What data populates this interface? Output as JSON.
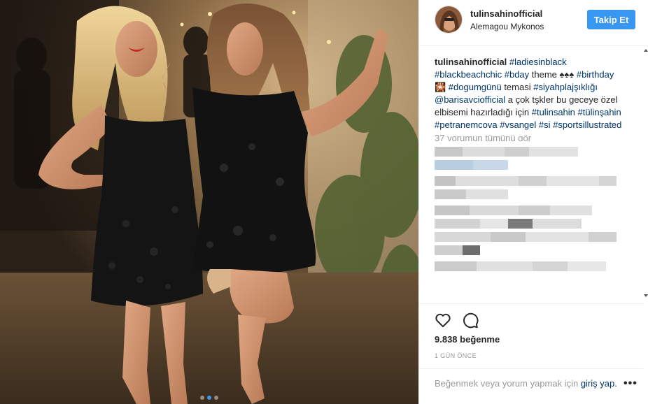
{
  "post": {
    "username": "tulinsahinofficial",
    "location": "Alemagou Mykonos",
    "follow_label": "Takip Et"
  },
  "caption": {
    "author": "tulinsahinofficial",
    "parts": [
      {
        "type": "tag",
        "text": "#ladiesinblack"
      },
      {
        "type": "tag",
        "text": "#blackbeachchic"
      },
      {
        "type": "tag",
        "text": "#bday"
      },
      {
        "type": "text",
        "text": "theme ♠♠♠"
      },
      {
        "type": "tag",
        "text": "#birthday"
      },
      {
        "type": "text",
        "text": "🎇"
      },
      {
        "type": "tag",
        "text": "#dogumgünü"
      },
      {
        "type": "text",
        "text": "temasi"
      },
      {
        "type": "tag",
        "text": "#siyahplajşıklığı"
      },
      {
        "type": "tag",
        "text": "@barisavciofficial"
      },
      {
        "type": "text",
        "text": "a çok tşkler bu geceye özel elbisemi hazırladığı için"
      },
      {
        "type": "tag",
        "text": "#tulinsahin"
      },
      {
        "type": "tag",
        "text": "#tülinşahin"
      },
      {
        "type": "tag",
        "text": "#petranemcova"
      },
      {
        "type": "tag",
        "text": "#vsangel"
      },
      {
        "type": "tag",
        "text": "#si"
      },
      {
        "type": "tag",
        "text": "#sportsillustrated"
      }
    ],
    "load_more": "37 yorumun tümünü gör"
  },
  "stats": {
    "likes": "9.838 beğenme",
    "time": "1 GÜN ÖNCE"
  },
  "footer": {
    "prompt": "Beğenmek veya yorum yapmak için",
    "login_link": "giriş yap.",
    "more": "•••"
  },
  "icons": {
    "like": "heart-icon",
    "comment": "comment-icon",
    "more": "more-options-icon"
  },
  "colors": {
    "accent": "#3897f0",
    "link": "#003569",
    "muted": "#999999"
  },
  "carousel": {
    "count": 3,
    "active": 1
  }
}
